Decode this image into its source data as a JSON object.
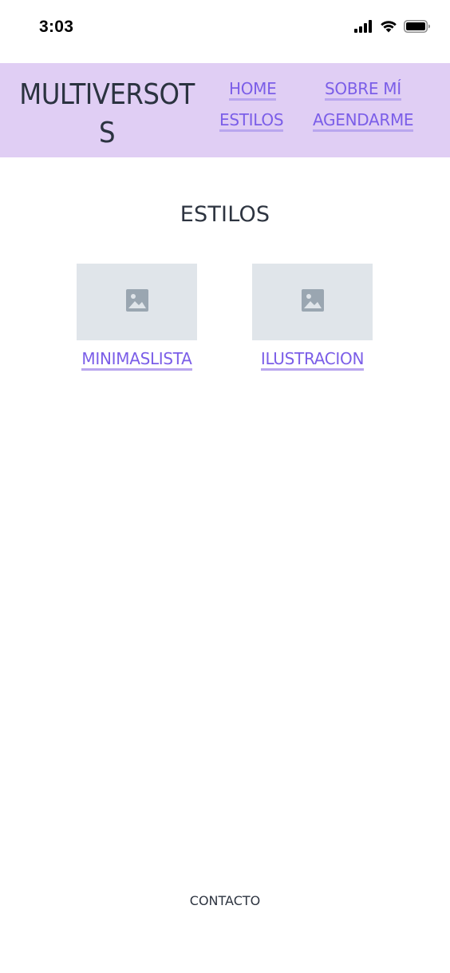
{
  "status_bar": {
    "time": "3:03",
    "icons": [
      "cellular-signal-icon",
      "wifi-icon",
      "battery-icon"
    ]
  },
  "header": {
    "brand": "MULTIVERSOTS",
    "background_color": "#e0cef4",
    "nav": {
      "home": "HOME",
      "sobre_mi": "SOBRE MÍ",
      "estilos": "ESTILOS",
      "agendarme": "AGENDARME"
    },
    "link_color": "#7b5ee8"
  },
  "main": {
    "title": "ESTILOS",
    "styles": [
      {
        "label": "MINIMASLISTA",
        "icon": "image-placeholder-icon"
      },
      {
        "label": "ILUSTRACION",
        "icon": "image-placeholder-icon"
      }
    ]
  },
  "footer": {
    "contact": "CONTACTO"
  }
}
